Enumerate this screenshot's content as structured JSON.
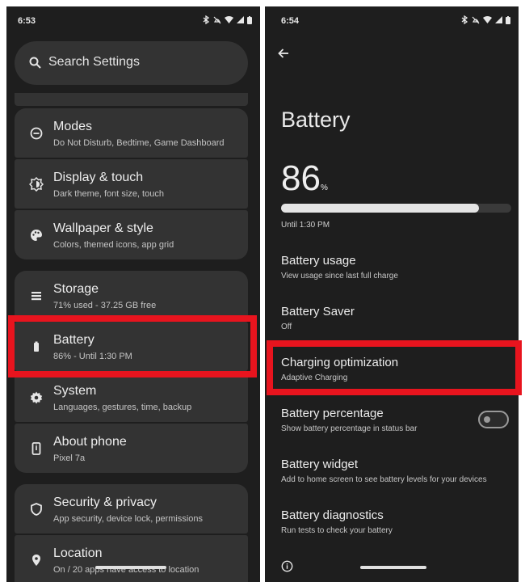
{
  "left": {
    "status": {
      "time": "6:53"
    },
    "search": {
      "placeholder": "Search Settings"
    },
    "items": [
      {
        "title": "Modes",
        "subtitle": "Do Not Disturb, Bedtime, Game Dashboard",
        "icon": "minus-circle-icon"
      },
      {
        "title": "Display & touch",
        "subtitle": "Dark theme, font size, touch",
        "icon": "brightness-icon"
      },
      {
        "title": "Wallpaper & style",
        "subtitle": "Colors, themed icons, app grid",
        "icon": "palette-icon"
      },
      {
        "title": "Storage",
        "subtitle": "71% used - 37.25 GB free",
        "icon": "storage-icon"
      },
      {
        "title": "Battery",
        "subtitle": "86% - Until 1:30 PM",
        "icon": "battery-icon"
      },
      {
        "title": "System",
        "subtitle": "Languages, gestures, time, backup",
        "icon": "gear-icon"
      },
      {
        "title": "About phone",
        "subtitle": "Pixel 7a",
        "icon": "phone-info-icon"
      },
      {
        "title": "Security & privacy",
        "subtitle": "App security, device lock, permissions",
        "icon": "shield-icon"
      },
      {
        "title": "Location",
        "subtitle": "On / 20 apps have access to location",
        "icon": "location-pin-icon"
      }
    ]
  },
  "right": {
    "status": {
      "time": "6:54"
    },
    "title": "Battery",
    "percent": "86",
    "percent_unit": "%",
    "level": 0.86,
    "until": "Until 1:30 PM",
    "items": [
      {
        "title": "Battery usage",
        "subtitle": "View usage since last full charge"
      },
      {
        "title": "Battery Saver",
        "subtitle": "Off"
      },
      {
        "title": "Charging optimization",
        "subtitle": "Adaptive Charging"
      },
      {
        "title": "Battery percentage",
        "subtitle": "Show battery percentage in status bar",
        "toggle": false
      },
      {
        "title": "Battery widget",
        "subtitle": "Add to home screen to see battery levels for your devices"
      },
      {
        "title": "Battery diagnostics",
        "subtitle": "Run tests to check your battery"
      }
    ]
  },
  "colors": {
    "highlight": "#e8141e",
    "background": "#1e1e1e",
    "card": "#333333"
  }
}
